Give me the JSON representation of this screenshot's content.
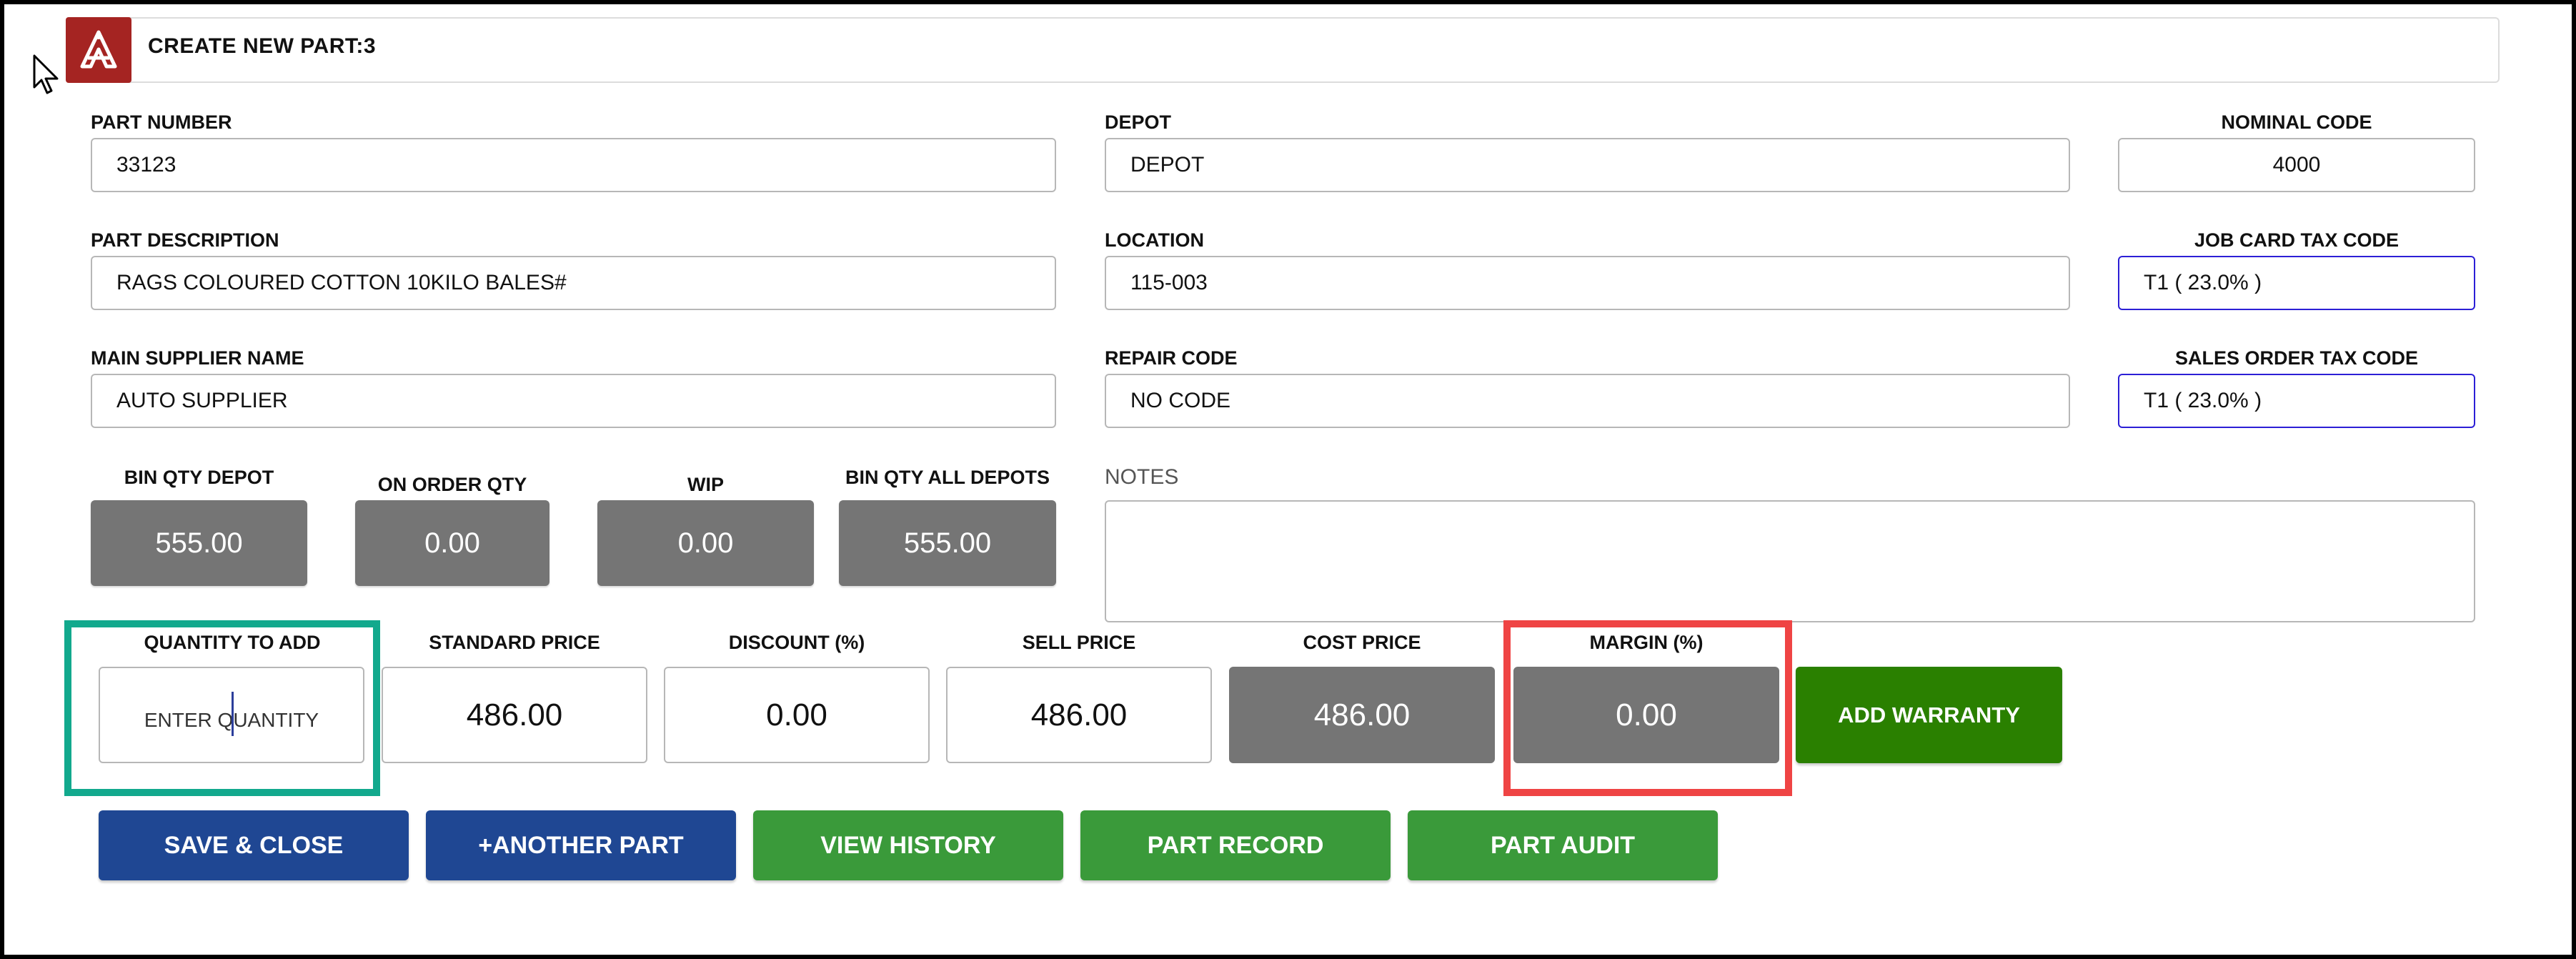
{
  "header": {
    "title": "CREATE NEW PART:3"
  },
  "fields": {
    "part_number": {
      "label": "PART NUMBER",
      "value": "33123"
    },
    "depot": {
      "label": "DEPOT",
      "value": "DEPOT"
    },
    "nominal_code": {
      "label": "NOMINAL CODE",
      "value": "4000"
    },
    "part_description": {
      "label": "PART DESCRIPTION",
      "value": "RAGS COLOURED COTTON 10KILO BALES#"
    },
    "location": {
      "label": "LOCATION",
      "value": "115-003"
    },
    "job_card_tax_code": {
      "label": "JOB CARD TAX CODE",
      "value": "T1 ( 23.0% )"
    },
    "main_supplier_name": {
      "label": "MAIN SUPPLIER NAME",
      "value": "AUTO SUPPLIER"
    },
    "repair_code": {
      "label": "REPAIR CODE",
      "value": "NO CODE"
    },
    "sales_order_tax_code": {
      "label": "SALES ORDER TAX CODE",
      "value": "T1 ( 23.0% )"
    }
  },
  "stats": {
    "bin_qty_depot": {
      "label": "BIN QTY DEPOT",
      "value": "555.00"
    },
    "on_order_qty": {
      "label": "ON ORDER QTY",
      "value": "0.00"
    },
    "wip": {
      "label": "WIP",
      "value": "0.00"
    },
    "bin_qty_all_depots": {
      "label": "BIN QTY ALL DEPOTS",
      "value": "555.00"
    }
  },
  "notes": {
    "label": "NOTES",
    "value": ""
  },
  "pricing": {
    "quantity_to_add": {
      "label": "QUANTITY TO ADD",
      "placeholder": "ENTER QUANTITY"
    },
    "standard_price": {
      "label": "STANDARD PRICE",
      "value": "486.00"
    },
    "discount": {
      "label": "DISCOUNT (%)",
      "value": "0.00"
    },
    "sell_price": {
      "label": "SELL PRICE",
      "value": "486.00"
    },
    "cost_price": {
      "label": "COST PRICE",
      "value": "486.00"
    },
    "margin": {
      "label": "MARGIN (%)",
      "value": "0.00"
    }
  },
  "buttons": {
    "add_warranty": "ADD WARRANTY",
    "save_close": "SAVE & CLOSE",
    "another_part": "+ANOTHER PART",
    "view_history": "VIEW HISTORY",
    "part_record": "PART RECORD",
    "part_audit": "PART AUDIT"
  },
  "colors": {
    "brand": "#a52422",
    "primary_button": "#1f4793",
    "secondary_button": "#3a9a3a",
    "warranty_button": "#2a8000",
    "highlight_teal": "#12a98d",
    "highlight_red": "#ef4444"
  }
}
